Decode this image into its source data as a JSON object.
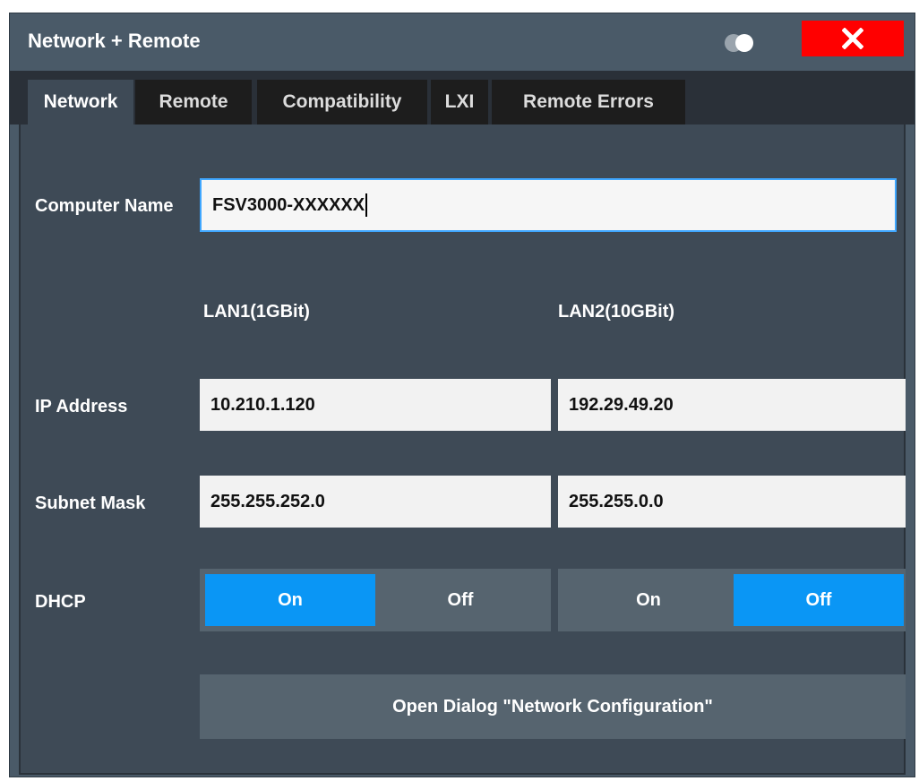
{
  "window": {
    "title": "Network + Remote",
    "icons": {
      "toggle": "display-toggle-icon",
      "close": "close-icon"
    }
  },
  "tabs": [
    {
      "label": "Network",
      "active": true
    },
    {
      "label": "Remote",
      "active": false
    },
    {
      "label": "Compatibility",
      "active": false
    },
    {
      "label": "LXI",
      "active": false
    },
    {
      "label": "Remote Errors",
      "active": false
    }
  ],
  "network": {
    "computer_name_label": "Computer Name",
    "computer_name_value": "FSV3000-XXXXXX",
    "lan1_header": "LAN1(1GBit)",
    "lan2_header": "LAN2(10GBit)",
    "ip_label": "IP Address",
    "ip_lan1": "10.210.1.120",
    "ip_lan2": "192.29.49.20",
    "subnet_label": "Subnet Mask",
    "subnet_lan1": "255.255.252.0",
    "subnet_lan2": "255.255.0.0",
    "dhcp_label": "DHCP",
    "dhcp_on_label": "On",
    "dhcp_off_label": "Off",
    "dhcp_lan1": "On",
    "dhcp_lan2": "Off",
    "open_dialog_label": "Open Dialog \"Network Configuration\""
  },
  "colors": {
    "accent": "#0a96f5",
    "close": "#ff0000",
    "focus_border": "#3fa7ff"
  }
}
